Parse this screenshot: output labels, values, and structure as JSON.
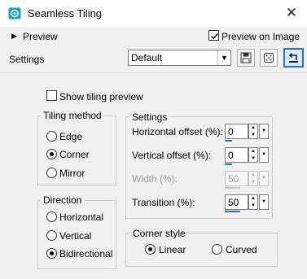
{
  "window": {
    "title": "Seamless Tiling",
    "icon": "paint-palette-icon",
    "close_glyph": "✕"
  },
  "preview": {
    "label": "Preview",
    "preview_on_image_label": "Preview on Image",
    "preview_on_image_checked": true
  },
  "settings_row": {
    "label": "Settings",
    "preset_value": "Default"
  },
  "show_tiling_preview": {
    "label": "Show tiling preview",
    "checked": false
  },
  "tiling_method": {
    "title": "Tiling method",
    "options": [
      "Edge",
      "Corner",
      "Mirror"
    ],
    "selected": "Corner"
  },
  "direction": {
    "title": "Direction",
    "options": [
      "Horizontal",
      "Vertical",
      "Bidirectional"
    ],
    "selected": "Bidirectional"
  },
  "settings_group": {
    "title": "Settings",
    "horizontal_offset": {
      "label": "Horizontal offset (%):",
      "value": "0",
      "level": 0
    },
    "vertical_offset": {
      "label": "Vertical offset (%):",
      "value": "0",
      "level": 0
    },
    "width": {
      "label": "Width (%):",
      "value": "50",
      "level": 50,
      "disabled": true
    },
    "transition": {
      "label": "Transition (%):",
      "value": "50",
      "level": 50
    }
  },
  "corner_style": {
    "title": "Corner style",
    "options": [
      "Linear",
      "Curved"
    ],
    "selected": "Linear"
  },
  "colors": {
    "accent": "#2372c4",
    "icon_teal": "#1ba3c6"
  }
}
